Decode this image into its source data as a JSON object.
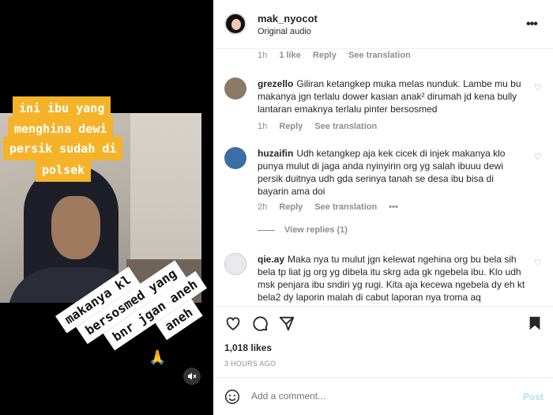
{
  "media": {
    "caption_lines": [
      "ini ibu yang",
      "menghina dewi",
      "persik sudah di",
      "polsek"
    ],
    "rotated_lines": [
      "makanya kl",
      "bersosmed yang",
      "bnr jgan aneh",
      "aneh"
    ],
    "emoji": "🙏"
  },
  "header": {
    "username": "mak_nyocot",
    "audio": "Original audio"
  },
  "comments": {
    "top_meta": {
      "time": "1h",
      "likes": "1 like",
      "reply": "Reply",
      "translate": "See translation"
    },
    "items": [
      {
        "user": "grezello",
        "text": "Giliran ketangkep muka melas nunduk. Lambe mu bu makanya jgn terlalu dower kasian anak² dirumah jd kena bully lantaran emaknya terlalu pinter bersosmed",
        "time": "1h",
        "reply": "Reply",
        "translate": "See translation"
      },
      {
        "user": "huzaifin",
        "text": "Udh ketangkep aja kek cicek di injek makanya klo punya mulut di jaga anda nyinyirin org yg salah ibuuu dewi persik duitnya udh gda serinya tanah se desa ibu bisa di bayarin ama doi",
        "time": "2h",
        "reply": "Reply",
        "translate": "See translation",
        "more": "•••"
      },
      {
        "user": "qie.ay",
        "text": "Maka nya tu mulut jgn kelewat ngehina org bu bela sih bela tp liat jg org yg dibela itu skrg ada gk ngebela ibu. Klo udh msk penjara ibu sndiri yg rugi. Kita aja kecewa ngebela dy eh kt bela2 dy laporin malah di cabut laporan nya troma aq"
      }
    ],
    "view_replies": "View replies (1)"
  },
  "actions": {
    "likes": "1,018 likes",
    "ago": "3 HOURS AGO"
  },
  "add_comment": {
    "placeholder": "Add a comment...",
    "post": "Post"
  },
  "colors": {
    "caption_bg": "#f5b32a",
    "post_disabled": "#b2dffc",
    "muted_text": "#8e8e8e"
  },
  "icons": [
    "heart-icon",
    "comment-icon",
    "share-icon",
    "bookmark-icon",
    "mute-icon",
    "more-icon",
    "emoji-icon"
  ]
}
